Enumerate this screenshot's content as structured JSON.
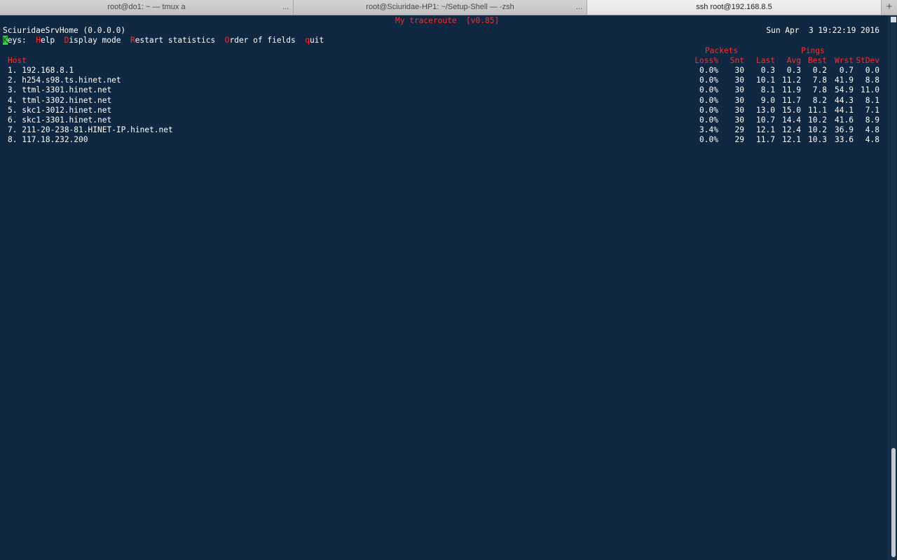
{
  "tabs": [
    {
      "title": "root@do1: ~ — tmux a",
      "more": "..."
    },
    {
      "title": "root@Sciuridae-HP1: ~/Setup-Shell — -zsh",
      "more": "..."
    },
    {
      "title": "ssh root@192.168.8.5",
      "more": ""
    }
  ],
  "new_tab": "+",
  "mtr": {
    "title": "My traceroute  [v0.85]",
    "local_host": "SciuridaeSrvHome (0.0.0.0)",
    "datetime": "Sun Apr  3 19:22:19 2016",
    "keys": {
      "label_first": "K",
      "label_rest": "eys:",
      "items": [
        {
          "key": "H",
          "rest": "elp"
        },
        {
          "key": "D",
          "rest": "isplay mode"
        },
        {
          "key": "R",
          "rest": "estart statistics"
        },
        {
          "key": "O",
          "rest": "rder of fields"
        },
        {
          "key": "q",
          "rest": "uit"
        }
      ]
    },
    "group_packets": "Packets",
    "group_pings": "Pings",
    "columns": [
      "Host",
      "Loss%",
      "Snt",
      "Last",
      "Avg",
      "Best",
      "Wrst",
      "StDev"
    ],
    "rows": [
      {
        "host": "1. 192.168.8.1",
        "loss": "0.0%",
        "snt": "30",
        "last": "0.3",
        "avg": "0.3",
        "best": "0.2",
        "wrst": "0.7",
        "stdev": "0.0"
      },
      {
        "host": "2. h254.s98.ts.hinet.net",
        "loss": "0.0%",
        "snt": "30",
        "last": "10.1",
        "avg": "11.2",
        "best": "7.8",
        "wrst": "41.9",
        "stdev": "8.8"
      },
      {
        "host": "3. ttml-3301.hinet.net",
        "loss": "0.0%",
        "snt": "30",
        "last": "8.1",
        "avg": "11.9",
        "best": "7.8",
        "wrst": "54.9",
        "stdev": "11.0"
      },
      {
        "host": "4. ttml-3302.hinet.net",
        "loss": "0.0%",
        "snt": "30",
        "last": "9.0",
        "avg": "11.7",
        "best": "8.2",
        "wrst": "44.3",
        "stdev": "8.1"
      },
      {
        "host": "5. skc1-3012.hinet.net",
        "loss": "0.0%",
        "snt": "30",
        "last": "13.0",
        "avg": "15.0",
        "best": "11.1",
        "wrst": "44.1",
        "stdev": "7.1"
      },
      {
        "host": "6. skc1-3301.hinet.net",
        "loss": "0.0%",
        "snt": "30",
        "last": "10.7",
        "avg": "14.4",
        "best": "10.2",
        "wrst": "41.6",
        "stdev": "8.9"
      },
      {
        "host": "7. 211-20-238-81.HINET-IP.hinet.net",
        "loss": "3.4%",
        "snt": "29",
        "last": "12.1",
        "avg": "12.4",
        "best": "10.2",
        "wrst": "36.9",
        "stdev": "4.8"
      },
      {
        "host": "8. 117.18.232.200",
        "loss": "0.0%",
        "snt": "29",
        "last": "11.7",
        "avg": "12.1",
        "best": "10.3",
        "wrst": "33.6",
        "stdev": "4.8"
      }
    ]
  },
  "colors": {
    "background": "#0f2740",
    "accent": "#ff2a2a",
    "cursor": "#3fd03f"
  }
}
